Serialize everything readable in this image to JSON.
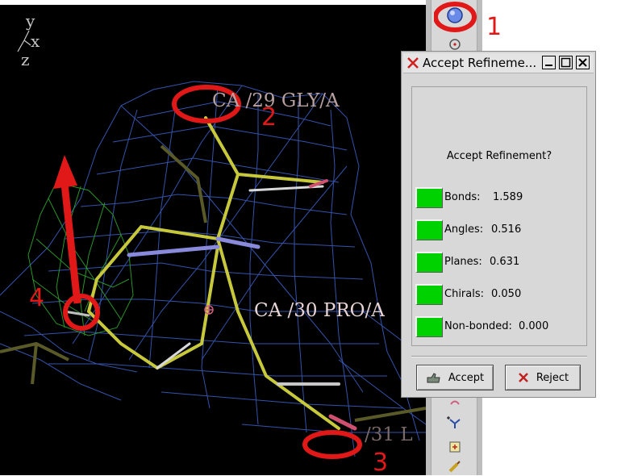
{
  "viewport": {
    "axes": {
      "y": "y",
      "x": "x",
      "z": "z"
    },
    "labels": {
      "residue_29": "CA /29 GLY/A",
      "residue_30": "CA /30 PRO/A",
      "residue_31": "/31 L"
    },
    "annotations": {
      "n1": "1",
      "n2": "2",
      "n3": "3",
      "n4": "4"
    }
  },
  "dialog": {
    "title": "Accept Refineme...",
    "question": "Accept Refinement?",
    "rows": [
      {
        "label": "Bonds:",
        "value": "1.589"
      },
      {
        "label": "Angles:",
        "value": "0.516"
      },
      {
        "label": "Planes:",
        "value": "0.631"
      },
      {
        "label": "Chirals:",
        "value": "0.050"
      },
      {
        "label": "Non-bonded:",
        "value": "0.000"
      }
    ],
    "accept_label": "Accept",
    "reject_label": "Reject"
  },
  "colors": {
    "indicator_green": "#00d200",
    "annotation_red": "#e01818",
    "map_blue": "#3e62c8",
    "map_green": "#2fa32f",
    "bond_yellow": "#c8c83c"
  }
}
